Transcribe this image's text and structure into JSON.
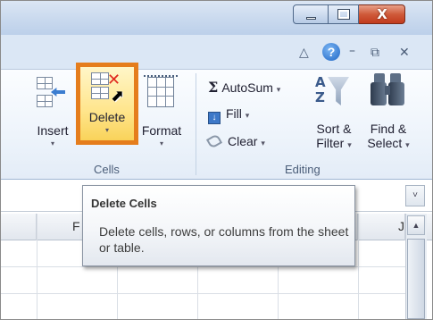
{
  "window": {
    "minimize_icon": "minimize-icon",
    "maximize_icon": "maximize-icon",
    "close_symbol": "X"
  },
  "tabrow": {
    "collapse_symbol": "△",
    "help_symbol": "?",
    "min_symbol": "–",
    "restore_symbol": "⧉",
    "close_symbol": "✕"
  },
  "ribbon": {
    "cells": {
      "insert_label": "Insert",
      "delete_label": "Delete",
      "format_label": "Format",
      "dropdown_symbol": "▾",
      "group_label": "Cells"
    },
    "editing": {
      "autosum_label": "AutoSum",
      "fill_label": "Fill",
      "clear_label": "Clear",
      "sort_label_1": "Sort &",
      "sort_label_2": "Filter",
      "find_label_1": "Find &",
      "find_label_2": "Select",
      "dropdown_symbol": "▾",
      "group_label": "Editing"
    }
  },
  "formula_bar": {
    "expand_symbol": "˅"
  },
  "grid": {
    "col_f": "F",
    "col_j": "J"
  },
  "tooltip": {
    "title": "Delete Cells",
    "body": "Delete cells, rows, or columns from the sheet or table."
  },
  "colors": {
    "highlight_border": "#e57d1c",
    "highlight_fill": "#ffe58c",
    "close_button": "#c23b1d"
  }
}
